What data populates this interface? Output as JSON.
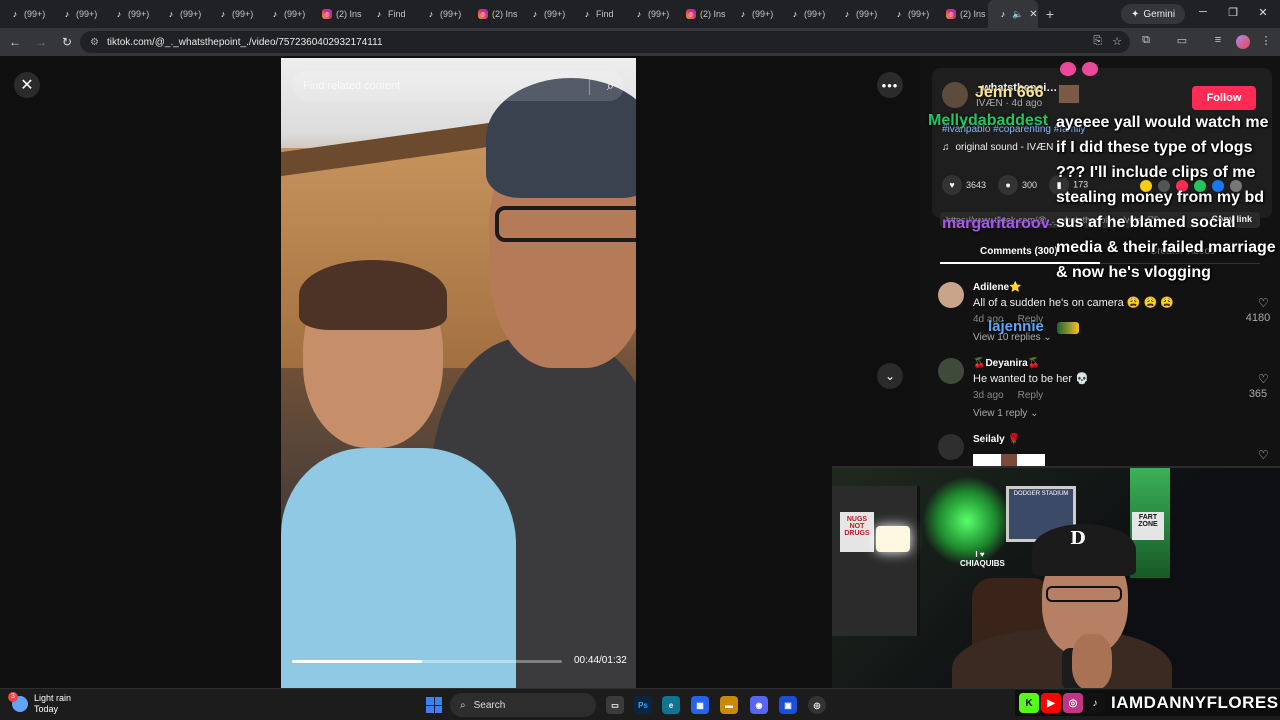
{
  "browser": {
    "tabs": [
      {
        "label": "(99+)",
        "favicon": "tiktok-icon"
      },
      {
        "label": "(99+)",
        "favicon": "tiktok-icon"
      },
      {
        "label": "(99+)",
        "favicon": "tiktok-icon"
      },
      {
        "label": "(99+)",
        "favicon": "tiktok-icon"
      },
      {
        "label": "(99+)",
        "favicon": "tiktok-icon"
      },
      {
        "label": "(99+)",
        "favicon": "tiktok-icon"
      },
      {
        "label": "(2) Ins",
        "favicon": "instagram-icon"
      },
      {
        "label": "Find",
        "favicon": "tiktok-icon"
      },
      {
        "label": "(99+)",
        "favicon": "tiktok-icon"
      },
      {
        "label": "(2) Ins",
        "favicon": "instagram-icon"
      },
      {
        "label": "(99+)",
        "favicon": "tiktok-icon"
      },
      {
        "label": "Find",
        "favicon": "tiktok-icon"
      },
      {
        "label": "(99+)",
        "favicon": "tiktok-icon"
      },
      {
        "label": "(2) Ins",
        "favicon": "instagram-icon"
      },
      {
        "label": "(99+)",
        "favicon": "tiktok-icon"
      },
      {
        "label": "(99+)",
        "favicon": "tiktok-icon"
      },
      {
        "label": "(99+)",
        "favicon": "tiktok-icon"
      },
      {
        "label": "(99+)",
        "favicon": "tiktok-icon"
      },
      {
        "label": "(2) Ins",
        "favicon": "instagram-icon"
      }
    ],
    "gemini_label": "Gemini",
    "url": "tiktok.com/@_._whatsthepoint_./video/7572360402932174111"
  },
  "video": {
    "search_placeholder": "Find related content",
    "time": "00:44/01:32",
    "progress": 0.48
  },
  "author": {
    "name": "_whatsthepoi…",
    "subtitle": "IVÆN · 4d ago",
    "follow_label": "Follow",
    "hashtags": "#ivanpablo #coparenting #family",
    "sound": "original sound - IVÆN"
  },
  "stats": {
    "likes": "3643",
    "comments": "300",
    "saves": "173"
  },
  "share": {
    "url": "https://www.tiktok.com/@_._whatsthepoint_./video/75...",
    "copy_label": "Copy link"
  },
  "tabs": {
    "comments": "Comments (300)",
    "creator": "Creator videos"
  },
  "comments": [
    {
      "user": "Adilene⭐",
      "text": "All of a sudden he's on camera 😩 😩 😩",
      "time": "4d ago",
      "reply": "Reply",
      "replies": "View 10 replies ⌄",
      "likes": "4180"
    },
    {
      "user": "🍒Deyanira🍒",
      "text": "He wanted to be her 💀",
      "time": "3d ago",
      "reply": "Reply",
      "replies": "View 1 reply ⌄",
      "likes": "365"
    },
    {
      "user": "Seilaly 🌹",
      "text": "",
      "time": "",
      "reply": "",
      "replies": "",
      "likes": ""
    }
  ],
  "stream": {
    "chat_name1": "Jenn 666",
    "chat_name2": "Mellydabaddest",
    "chat_message": "ayeeee yall would watch me if I did these type of vlogs ??? I'll include clips of me stealing money from my bd sus af he blamed social media & their failed marriage & now he's vlogging",
    "chat_name3": "margaritaroov",
    "chat_name4": "lajennie",
    "handle": "IAMDANNYFLORES",
    "webcam_poster": "DODGER STADIUM",
    "webcam_sign1": "NUGS NOT DRUGS",
    "webcam_sign2": "I ♥ CHIAQUIBS",
    "webcam_sign3": "FART ZONE"
  },
  "taskbar": {
    "weather_label": "Light rain",
    "weather_sub": "Today",
    "weather_badge": "3",
    "search_label": "Search"
  },
  "colors": {
    "follow": "#fe2c55",
    "chat_name1": "#fde68a",
    "chat_name2": "#22c55e",
    "chat_name3": "#a855f7",
    "chat_name4": "#60a5fa"
  }
}
